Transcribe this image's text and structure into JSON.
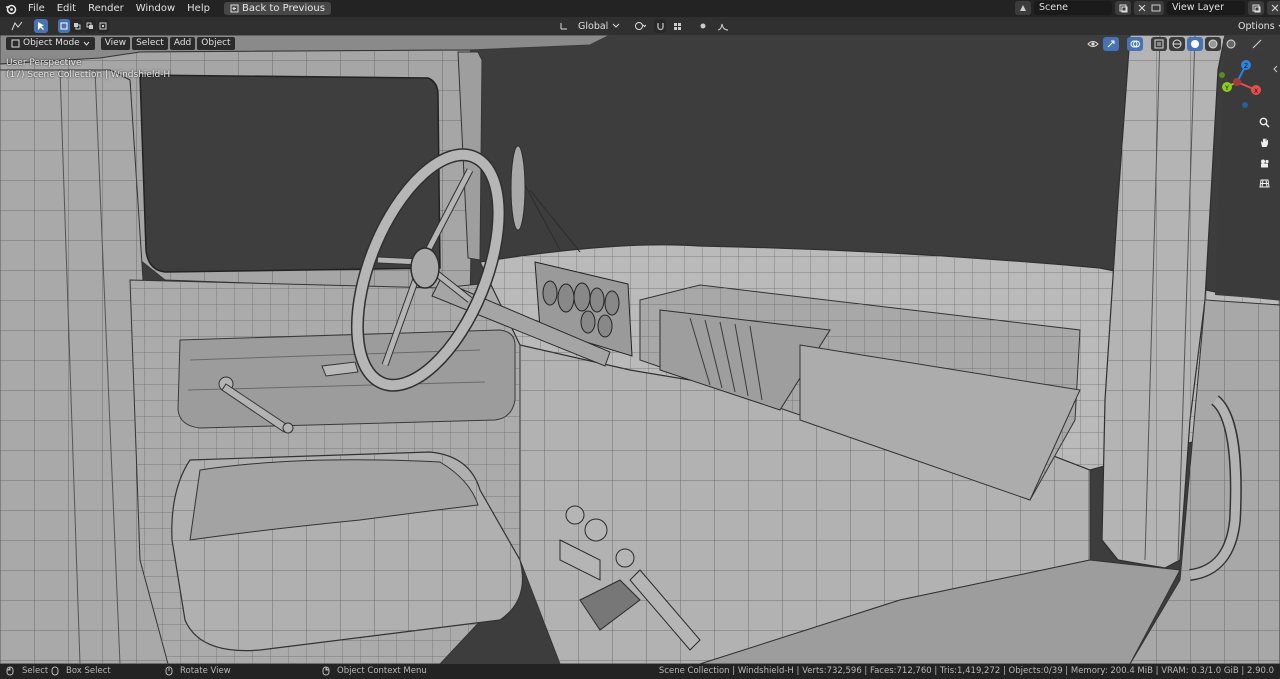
{
  "topbar": {
    "menus": [
      "File",
      "Edit",
      "Render",
      "Window",
      "Help"
    ],
    "back_label": "Back to Previous",
    "scene_name": "Scene",
    "view_layer": "View Layer"
  },
  "header": {
    "orientation": "Global",
    "options": "Options"
  },
  "viewport_header": {
    "mode": "Object Mode",
    "menus": [
      "View",
      "Select",
      "Add",
      "Object"
    ]
  },
  "overlay": {
    "perspective": "User Perspective",
    "collection": "(17) Scene Collection | Windshield-H"
  },
  "gizmo": {
    "x_label": "X",
    "y_label": "Y",
    "z_label": "Z"
  },
  "statusbar": {
    "select": "Select",
    "box_select": "Box Select",
    "rotate": "Rotate View",
    "context_menu": "Object Context Menu",
    "stats": "Scene Collection | Windshield-H | Verts:732,596 | Faces:712,760 | Tris:1,419,272 | Objects:0/39 | Memory: 200.4 MiB | VRAM: 0.3/1.0 GiB | 2.90.0"
  },
  "colors": {
    "accent": "#4772b3",
    "axis_x": "#e84d4d",
    "axis_y": "#8ac926",
    "axis_z": "#2f83e0"
  }
}
